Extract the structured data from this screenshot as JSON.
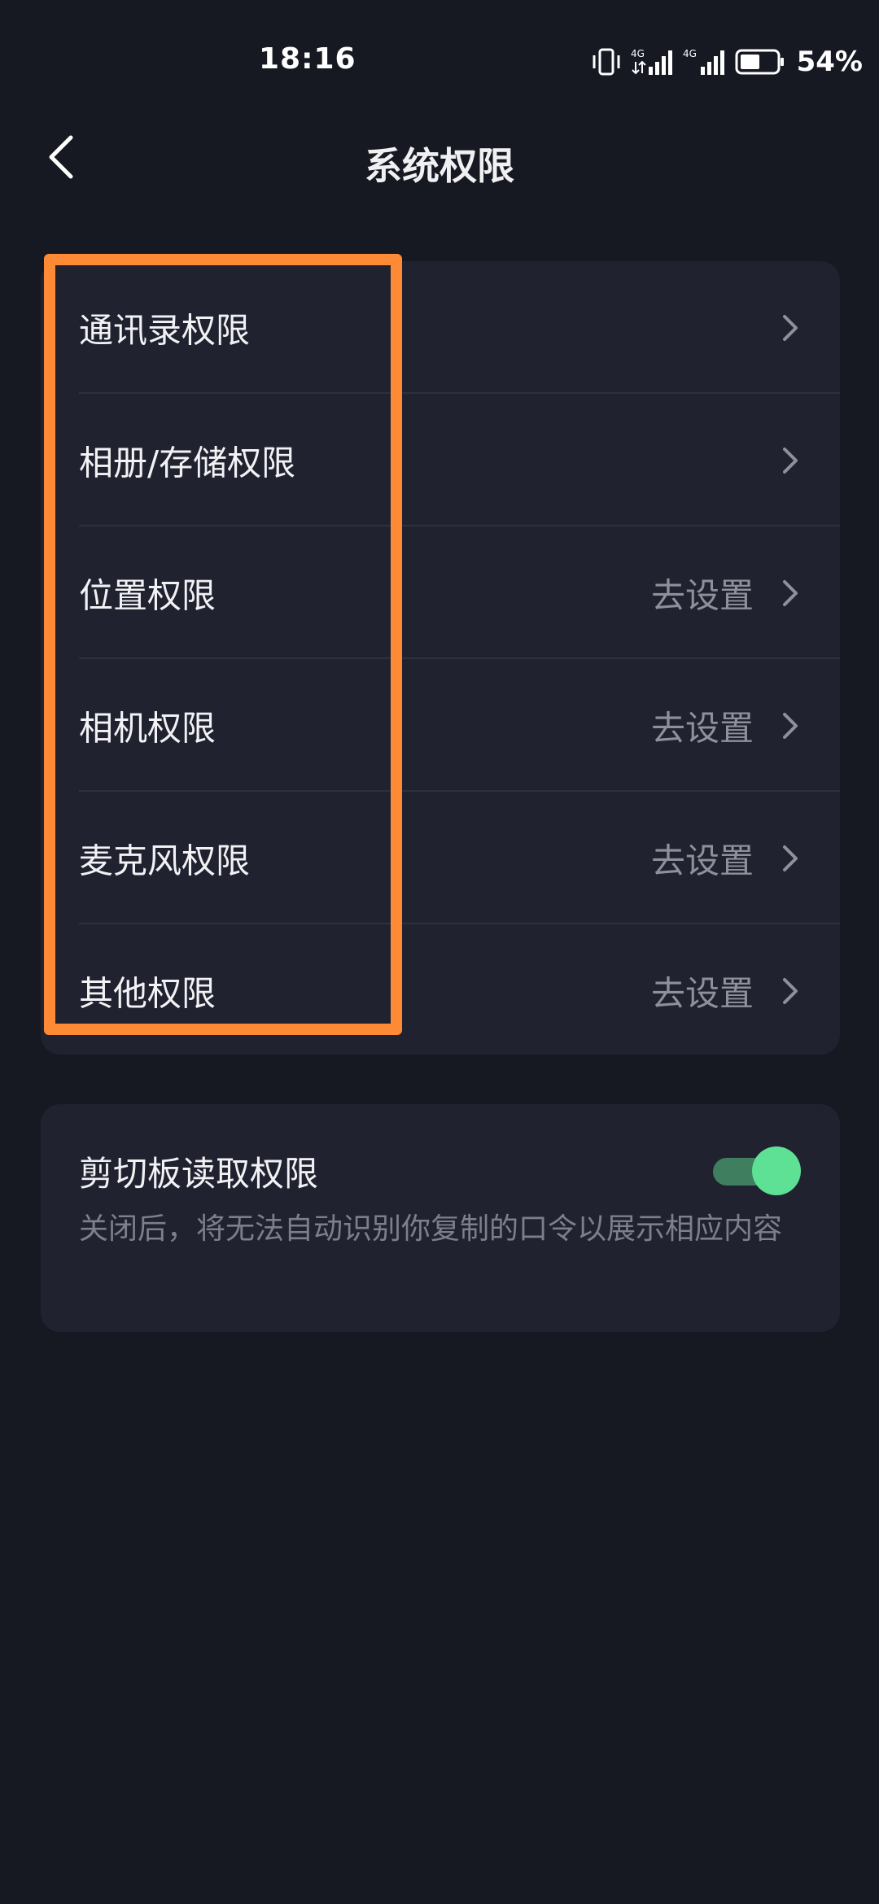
{
  "status_bar": {
    "time": "18:16",
    "network_1": "4G",
    "network_2": "4G",
    "battery_percent": "54%",
    "battery_level": 0.54
  },
  "header": {
    "title": "系统权限"
  },
  "permissions": [
    {
      "label": "通讯录权限",
      "action": ""
    },
    {
      "label": "相册/存储权限",
      "action": ""
    },
    {
      "label": "位置权限",
      "action": "去设置"
    },
    {
      "label": "相机权限",
      "action": "去设置"
    },
    {
      "label": "麦克风权限",
      "action": "去设置"
    },
    {
      "label": "其他权限",
      "action": "去设置"
    }
  ],
  "clipboard": {
    "title": "剪切板读取权限",
    "description": "关闭后，将无法自动识别你复制的口令以展示相应内容",
    "enabled": true
  },
  "colors": {
    "background": "#161822",
    "card": "#202230",
    "highlight": "#ff8a36",
    "toggle_on": "#5ee095"
  }
}
